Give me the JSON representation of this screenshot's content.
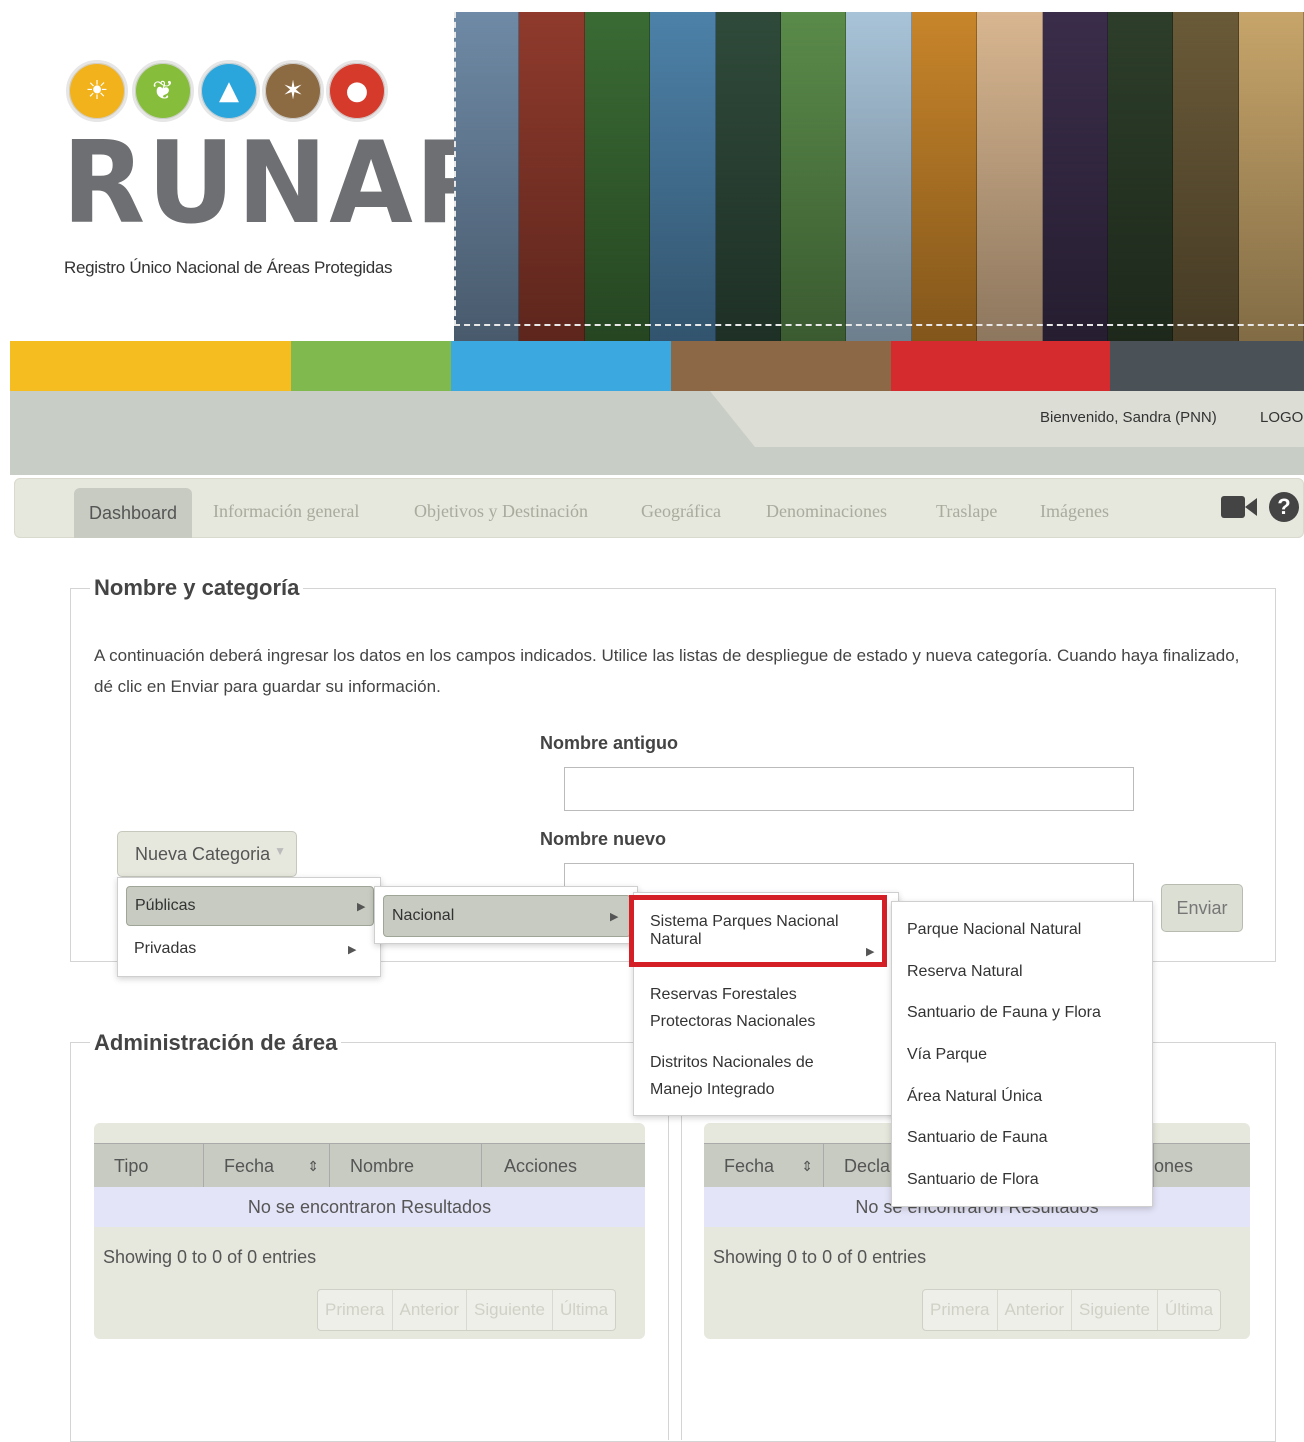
{
  "header": {
    "logo_text": "RUNAP",
    "logo_subtitle": "Registro Único Nacional de Áreas Protegidas",
    "logo_circles": [
      {
        "icon": "palm-tree-icon",
        "color": "#f2b21c"
      },
      {
        "icon": "leaf-icon",
        "color": "#86bd3a"
      },
      {
        "icon": "mountain-icon",
        "color": "#2aa6dc"
      },
      {
        "icon": "grass-icon",
        "color": "#8c6a42"
      },
      {
        "icon": "bear-icon",
        "color": "#d53a2b"
      }
    ],
    "banner_colors": [
      "#6f8aa6",
      "#8f3a2c",
      "#3a6b34",
      "#4d81a8",
      "#2f4a3a",
      "#5a8b4a",
      "#a8c3d8",
      "#c8852a",
      "#d8b690",
      "#3a2d4a",
      "#2d3e2a",
      "#6a5a38",
      "#c7a56a"
    ],
    "color_bar": [
      {
        "color": "#f5bd20",
        "flex": 281
      },
      {
        "color": "#80ba4e",
        "flex": 160
      },
      {
        "color": "#3ba9df",
        "flex": 220
      },
      {
        "color": "#8c6846",
        "flex": 220
      },
      {
        "color": "#d52b2e",
        "flex": 219
      },
      {
        "color": "#4a5258",
        "flex": 194
      }
    ],
    "welcome": "Bienvenido, Sandra (PNN)",
    "logout": "LOGOU"
  },
  "tabs": {
    "active": "Dashboard",
    "items": [
      "Información general",
      "Objetivos y Destinación",
      "Geográfica",
      "Denominaciones",
      "Traslape",
      "Imágenes"
    ],
    "video_icon": "video-camera-icon",
    "help_icon": "help-icon",
    "help_glyph": "?"
  },
  "form": {
    "legend": "Nombre y categoría",
    "instructions": "A continuación deberá ingresar los datos en los campos indicados. Utilice las listas de despliegue de estado y nueva categoría. Cuando haya finalizado, dé clic en Enviar para guardar su información.",
    "old_name_label": "Nombre antiguo",
    "old_name_value": "",
    "new_name_label": "Nombre nuevo",
    "new_name_value": "",
    "category_button": "Nueva Categoria",
    "submit": "Enviar"
  },
  "menus": {
    "level1": [
      "Públicas",
      "Privadas"
    ],
    "level2": [
      "Nacional"
    ],
    "level3": [
      "Sistema Parques Nacional Natural",
      "Reservas Forestales Protectoras Nacionales",
      "Distritos Nacionales de Manejo Integrado"
    ],
    "level4": [
      "Parque Nacional Natural",
      "Reserva Natural",
      "Santuario de Fauna y Flora",
      "Vía Parque",
      "Área Natural Única",
      "Santuario de Fauna",
      "Santuario de Flora"
    ],
    "highlight_color": "#d51f27"
  },
  "admin": {
    "legend": "Administración de área",
    "table1": {
      "columns": [
        "Tipo",
        "Fecha",
        "Nombre",
        "Acciones"
      ],
      "empty": "No se encontraron Resultados",
      "showing": "Showing 0 to 0 of 0 entries",
      "pager": [
        "Primera",
        "Anterior",
        "Siguiente",
        "Última"
      ]
    },
    "table2": {
      "columns": [
        "Fecha",
        "Decla",
        "ones"
      ],
      "empty": "No se encontraron Resultados",
      "showing": "Showing 0 to 0 of 0 entries",
      "pager": [
        "Primera",
        "Anterior",
        "Siguiente",
        "Última"
      ]
    }
  }
}
